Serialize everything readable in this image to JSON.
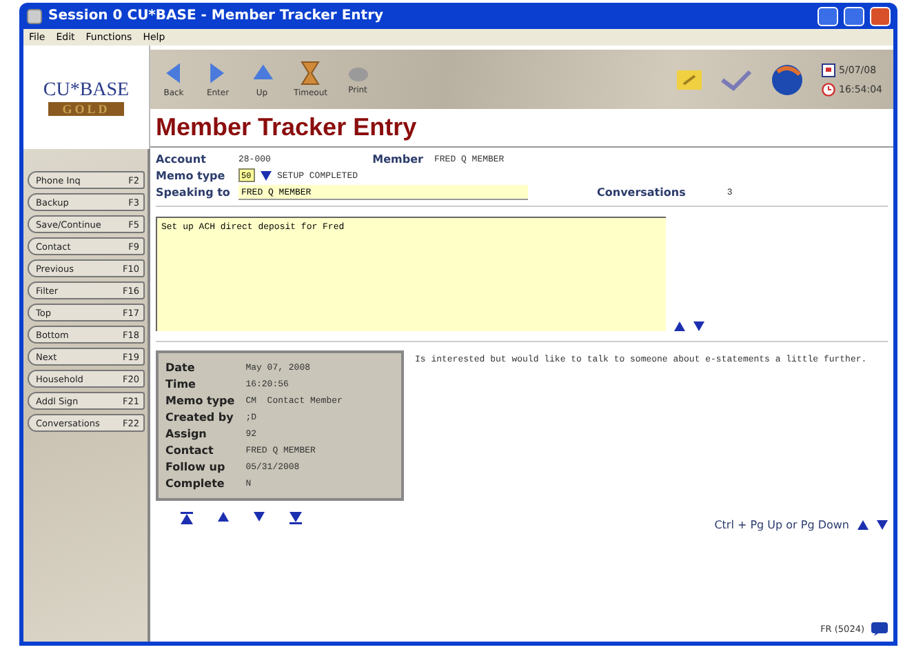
{
  "window": {
    "title": "Session 0 CU*BASE - Member Tracker Entry"
  },
  "menu": [
    "File",
    "Edit",
    "Functions",
    "Help"
  ],
  "logo": {
    "name": "CU*BASE",
    "edition": "GOLD"
  },
  "toolbar": [
    {
      "label": "Back",
      "kind": "back"
    },
    {
      "label": "Enter",
      "kind": "enter"
    },
    {
      "label": "Up",
      "kind": "up"
    },
    {
      "label": "Timeout",
      "kind": "timeout"
    },
    {
      "label": "Print",
      "kind": "print"
    }
  ],
  "clock": {
    "date": "5/07/08",
    "time": "16:54:04"
  },
  "page_title": "Member Tracker Entry",
  "sidebar": [
    {
      "label": "Phone Inq",
      "key": "F2"
    },
    {
      "label": "Backup",
      "key": "F3"
    },
    {
      "label": "Save/Continue",
      "key": "F5"
    },
    {
      "label": "Contact",
      "key": "F9"
    },
    {
      "label": "Previous",
      "key": "F10"
    },
    {
      "label": "Filter",
      "key": "F16"
    },
    {
      "label": "Top",
      "key": "F17"
    },
    {
      "label": "Bottom",
      "key": "F18"
    },
    {
      "label": "Next",
      "key": "F19"
    },
    {
      "label": "Household",
      "key": "F20"
    },
    {
      "label": "Addl Sign",
      "key": "F21"
    },
    {
      "label": "Conversations",
      "key": "F22"
    }
  ],
  "header": {
    "account_label": "Account",
    "account": "28-000",
    "member_label": "Member",
    "member": "FRED Q MEMBER",
    "memo_type_label": "Memo type",
    "memo_code": "50",
    "memo_desc": "SETUP COMPLETED",
    "speaking_label": "Speaking to",
    "speaking_to": "FRED Q MEMBER",
    "conversations_label": "Conversations",
    "conversations": "3"
  },
  "note": "Set up ACH direct deposit for Fred",
  "detail": [
    {
      "label": "Date",
      "value": "May 07, 2008"
    },
    {
      "label": "Time",
      "value": "16:20:56"
    },
    {
      "label": "Memo type",
      "value": "CM  Contact Member"
    },
    {
      "label": "Created by",
      "value": ";D"
    },
    {
      "label": "Assign",
      "value": "92"
    },
    {
      "label": "Contact",
      "value": "FRED Q MEMBER"
    },
    {
      "label": "Follow up",
      "value": "05/31/2008"
    },
    {
      "label": "Complete",
      "value": "N"
    }
  ],
  "comment": "Is interested but would like to talk to someone about e-statements a little further.",
  "page_hint": "Ctrl + Pg Up or Pg Down",
  "screen_id": "FR (5024)"
}
